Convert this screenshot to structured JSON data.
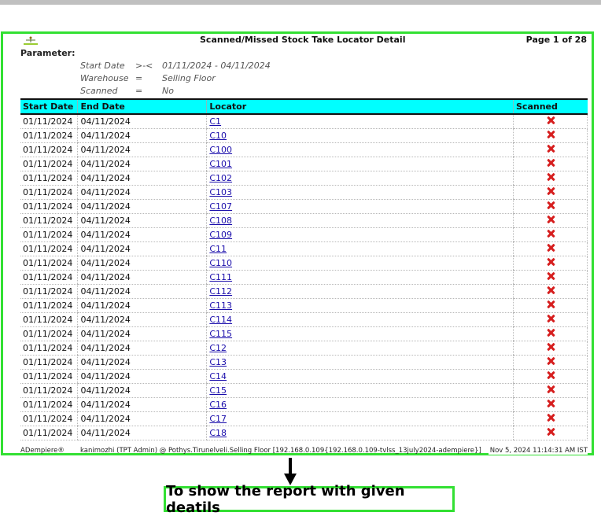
{
  "report": {
    "title": "Scanned/Missed Stock Take Locator Detail",
    "page_info": "Page 1 of 28",
    "parameter_heading": "Parameter:",
    "parameters": [
      {
        "name": "Start Date",
        "operator": ">-<",
        "value": "01/11/2024 - 04/11/2024"
      },
      {
        "name": "Warehouse",
        "operator": "=",
        "value": "Selling Floor"
      },
      {
        "name": "Scanned",
        "operator": "=",
        "value": "No"
      }
    ],
    "columns": [
      "Start Date",
      "End Date",
      "Locator",
      "Scanned"
    ],
    "rows": [
      {
        "start": "01/11/2024",
        "end": "04/11/2024",
        "locator": "C1",
        "scanned_icon": "red-x-icon"
      },
      {
        "start": "01/11/2024",
        "end": "04/11/2024",
        "locator": "C10",
        "scanned_icon": "red-x-icon"
      },
      {
        "start": "01/11/2024",
        "end": "04/11/2024",
        "locator": "C100",
        "scanned_icon": "red-x-icon"
      },
      {
        "start": "01/11/2024",
        "end": "04/11/2024",
        "locator": "C101",
        "scanned_icon": "red-x-icon"
      },
      {
        "start": "01/11/2024",
        "end": "04/11/2024",
        "locator": "C102",
        "scanned_icon": "red-x-icon"
      },
      {
        "start": "01/11/2024",
        "end": "04/11/2024",
        "locator": "C103",
        "scanned_icon": "red-x-icon"
      },
      {
        "start": "01/11/2024",
        "end": "04/11/2024",
        "locator": "C107",
        "scanned_icon": "red-x-icon"
      },
      {
        "start": "01/11/2024",
        "end": "04/11/2024",
        "locator": "C108",
        "scanned_icon": "red-x-icon"
      },
      {
        "start": "01/11/2024",
        "end": "04/11/2024",
        "locator": "C109",
        "scanned_icon": "red-x-icon"
      },
      {
        "start": "01/11/2024",
        "end": "04/11/2024",
        "locator": "C11",
        "scanned_icon": "red-x-icon"
      },
      {
        "start": "01/11/2024",
        "end": "04/11/2024",
        "locator": "C110",
        "scanned_icon": "red-x-icon"
      },
      {
        "start": "01/11/2024",
        "end": "04/11/2024",
        "locator": "C111",
        "scanned_icon": "red-x-icon"
      },
      {
        "start": "01/11/2024",
        "end": "04/11/2024",
        "locator": "C112",
        "scanned_icon": "red-x-icon"
      },
      {
        "start": "01/11/2024",
        "end": "04/11/2024",
        "locator": "C113",
        "scanned_icon": "red-x-icon"
      },
      {
        "start": "01/11/2024",
        "end": "04/11/2024",
        "locator": "C114",
        "scanned_icon": "red-x-icon"
      },
      {
        "start": "01/11/2024",
        "end": "04/11/2024",
        "locator": "C115",
        "scanned_icon": "red-x-icon"
      },
      {
        "start": "01/11/2024",
        "end": "04/11/2024",
        "locator": "C12",
        "scanned_icon": "red-x-icon"
      },
      {
        "start": "01/11/2024",
        "end": "04/11/2024",
        "locator": "C13",
        "scanned_icon": "red-x-icon"
      },
      {
        "start": "01/11/2024",
        "end": "04/11/2024",
        "locator": "C14",
        "scanned_icon": "red-x-icon"
      },
      {
        "start": "01/11/2024",
        "end": "04/11/2024",
        "locator": "C15",
        "scanned_icon": "red-x-icon"
      },
      {
        "start": "01/11/2024",
        "end": "04/11/2024",
        "locator": "C16",
        "scanned_icon": "red-x-icon"
      },
      {
        "start": "01/11/2024",
        "end": "04/11/2024",
        "locator": "C17",
        "scanned_icon": "red-x-icon"
      },
      {
        "start": "01/11/2024",
        "end": "04/11/2024",
        "locator": "C18",
        "scanned_icon": "red-x-icon"
      }
    ],
    "footer": {
      "brand": "ADempiere®",
      "session": "kanimozhi (TPT Admin) @ Pothys.Tirunelveli.Selling Floor [192.168.0.109{192.168.0.109-tvlss_13july2024-adempiere}]",
      "timestamp": "Nov 5, 2024 11:14:31 AM IST"
    }
  },
  "annotation": {
    "caption": "To show the report with given deatils"
  },
  "colors": {
    "highlight_border": "#33e033",
    "table_header_bg": "#00ffff",
    "link": "#1a0dab",
    "not_scanned": "#d61e1e"
  }
}
